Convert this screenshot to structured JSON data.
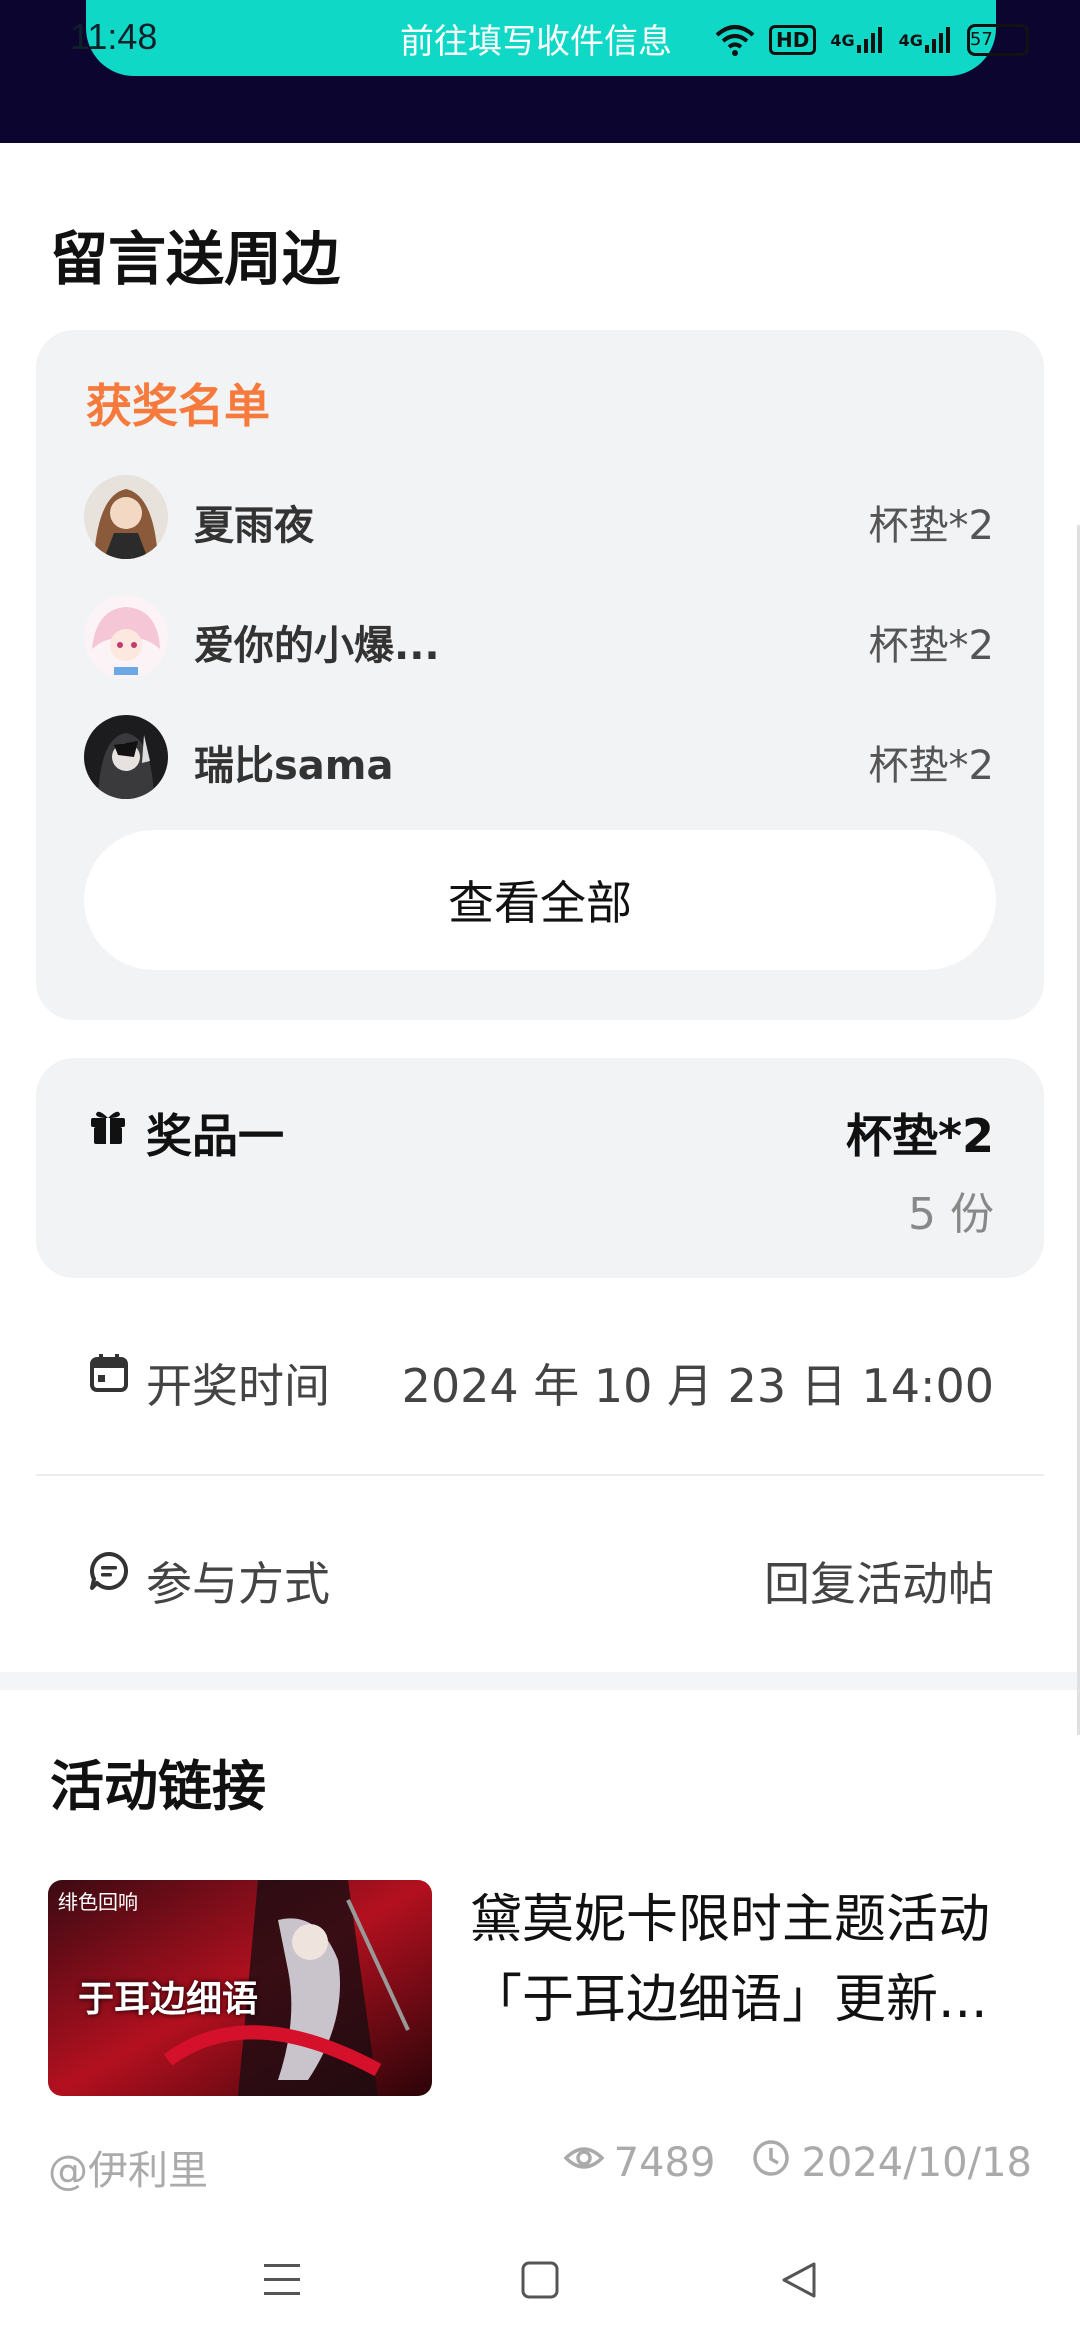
{
  "status_bar": {
    "time": "11:48",
    "notification": "前往填写收件信息",
    "hd_label": "HD",
    "signal1": "4G",
    "signal2": "4G",
    "battery": "57"
  },
  "comment_section": {
    "title": "留言送周边",
    "winners": {
      "heading": "获奖名单",
      "items": [
        {
          "name": "夏雨夜",
          "prize": "杯垫*2"
        },
        {
          "name": "爱你的小爆...",
          "prize": "杯垫*2"
        },
        {
          "name": "瑞比sama",
          "prize": "杯垫*2"
        }
      ],
      "view_all": "查看全部"
    },
    "prize": {
      "label": "奖品一",
      "value": "杯垫*2",
      "count": "5 份"
    },
    "draw_time": {
      "label": "开奖时间",
      "value": "2024 年 10 月 23 日 14:00"
    },
    "participation": {
      "label": "参与方式",
      "value": "回复活动帖"
    }
  },
  "activity_links": {
    "title": "活动链接",
    "item": {
      "title_line1": "黛莫妮卡限时主题活动",
      "title_line2": "「于耳边细语」更新...",
      "author": "@伊利里",
      "views": "7489",
      "date": "2024/10/18",
      "thumb_caption": "于耳边细语",
      "thumb_logo": "绯色回响"
    }
  },
  "colors": {
    "accent": "#f57a3c",
    "status_bg": "#0b0530",
    "pill": "#0fd8c6"
  }
}
